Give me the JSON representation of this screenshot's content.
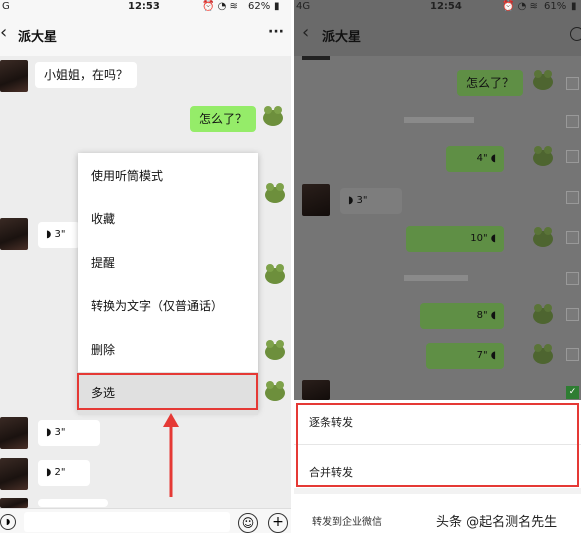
{
  "left": {
    "status": {
      "signal": "G",
      "time": "12:53",
      "battery": "62%"
    },
    "title": "派大星",
    "messages": {
      "greeting": "小姐姐，在吗？",
      "reply": "怎么了？",
      "voice_a": "3\"",
      "voice_b": "3\"",
      "voice_c": "2\""
    },
    "menu": [
      "使用听筒模式",
      "收藏",
      "提醒",
      "转换为文字（仅普通话）",
      "删除",
      "多选"
    ]
  },
  "right": {
    "status": {
      "signal": "4G",
      "time": "12:54",
      "battery": "61%"
    },
    "title": "派大星",
    "messages": {
      "reply": "怎么了？",
      "voice_in": "3\"",
      "voice_out": [
        "4\"",
        "10\"",
        "8\"",
        "7\""
      ]
    },
    "actions": [
      "逐条转发",
      "合并转发"
    ],
    "enterprise": "转发到企业微信"
  },
  "watermark": "头条 @起名测名先生",
  "colors": {
    "bubble_out": "#95ec69",
    "highlight": "#e53935",
    "chat_bg": "#ededed"
  }
}
